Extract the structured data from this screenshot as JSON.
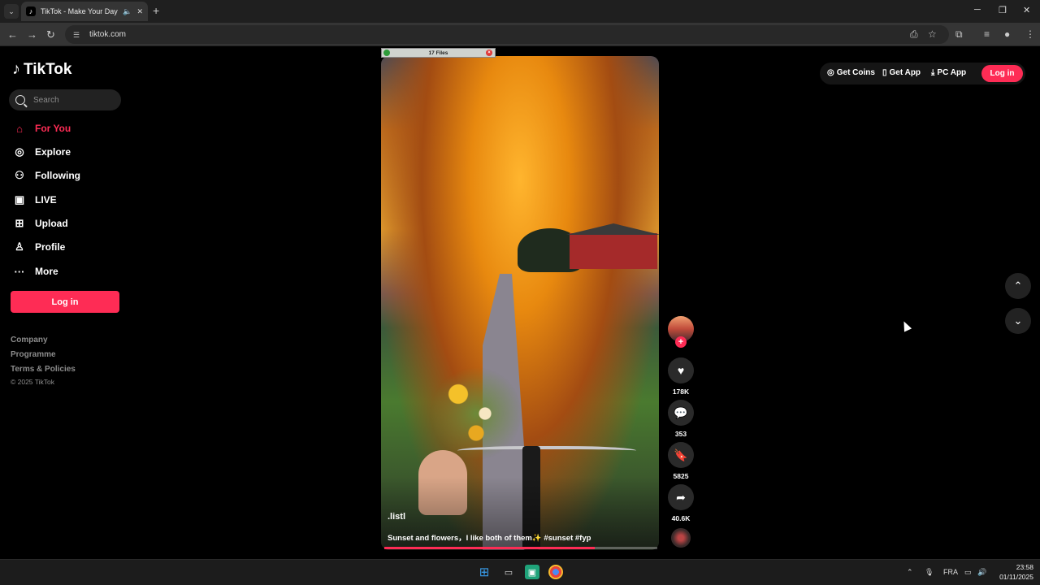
{
  "browser": {
    "tab_title": "TikTok - Make Your Day",
    "url": "tiktok.com",
    "tab_list_icon": "chevron-down-icon",
    "new_tab_label": "+",
    "minimize": "─",
    "restore": "❐",
    "close": "✕"
  },
  "sidebar": {
    "logo_text": "TikTok",
    "search_placeholder": "Search",
    "items": [
      {
        "label": "For You",
        "icon": "home-icon",
        "active": true
      },
      {
        "label": "Explore",
        "icon": "compass-icon"
      },
      {
        "label": "Following",
        "icon": "following-icon"
      },
      {
        "label": "LIVE",
        "icon": "live-tv-icon"
      },
      {
        "label": "Upload",
        "icon": "upload-plus-icon"
      },
      {
        "label": "Profile",
        "icon": "profile-icon"
      },
      {
        "label": "More",
        "icon": "more-dots-icon"
      }
    ],
    "login_label": "Log in",
    "footer_links": [
      "Company",
      "Programme",
      "Terms & Policies"
    ],
    "copyright": "© 2025 TikTok"
  },
  "overlay": {
    "title": "17 Files"
  },
  "video": {
    "author": ".listl",
    "caption": "Sunset and flowers，I like both of them✨ #sunset #fyp",
    "progress": 0.77
  },
  "actions": {
    "likes": "178K",
    "comments": "353",
    "saves": "5825",
    "shares": "40.6K"
  },
  "topbar": {
    "get_coins": "Get Coins",
    "get_app": "Get App",
    "pc_app": "PC App",
    "login": "Log in"
  },
  "taskbar": {
    "language": "FRA",
    "time": "23:58",
    "date": "01/11/2025"
  },
  "colors": {
    "accent": "#fe2c55",
    "background": "#000000"
  }
}
